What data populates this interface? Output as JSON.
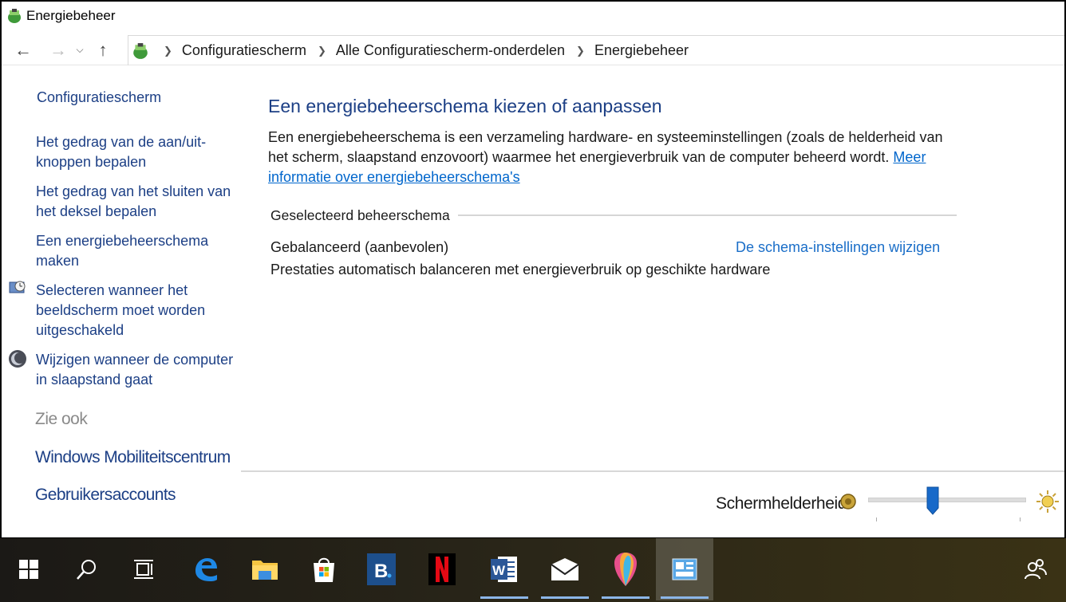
{
  "window": {
    "title": "Energiebeheer"
  },
  "addressbar": {
    "back_icon": "arrow-left-icon",
    "forward_icon": "arrow-right-icon",
    "recent_icon": "chevron-down-icon",
    "up_icon": "arrow-up-icon",
    "crumbs": [
      "Configuratiescherm",
      "Alle Configuratiescherm-onderdelen",
      "Energiebeheer"
    ]
  },
  "sidebar": {
    "home": "Configuratiescherm",
    "links": [
      "Het gedrag van de aan/uit-knoppen bepalen",
      "Het gedrag van het sluiten van het deksel bepalen",
      "Een energiebeheerschema maken",
      "Selecteren wanneer het beeldscherm moet worden uitgeschakeld",
      "Wijzigen wanneer de computer in slaapstand gaat"
    ],
    "see_also_title": "Zie ook",
    "see_also": [
      "Windows Mobiliteitscentrum",
      "Gebruikersaccounts"
    ]
  },
  "main": {
    "heading": "Een energiebeheerschema kiezen of aanpassen",
    "description": "Een energiebeheerschema is een verzameling hardware- en systeeminstellingen (zoals de helderheid van het scherm, slaapstand enzovoort) waarmee het energieverbruik van de computer beheerd wordt. ",
    "more_info_link": "Meer informatie over energiebeheerschema's",
    "group_title": "Geselecteerd beheerschema",
    "plan_name": "Gebalanceerd (aanbevolen)",
    "plan_change_link": "De schema-instellingen wijzigen",
    "plan_description": "Prestaties automatisch balanceren met energieverbruik op geschikte hardware"
  },
  "brightness": {
    "label": "Schermhelderheid:",
    "level_percent": 41
  },
  "taskbar": {
    "items": [
      "windows-start-icon",
      "search-icon",
      "task-view-icon",
      "edge-icon",
      "file-explorer-icon",
      "store-icon",
      "booking-icon",
      "netflix-icon",
      "word-icon",
      "mail-icon",
      "paint-3d-icon",
      "control-panel-icon"
    ],
    "tray": [
      "people-icon"
    ]
  },
  "colors": {
    "link": "#1c3f85",
    "accent": "#1a6ec8",
    "slider_thumb": "#1769c9"
  }
}
